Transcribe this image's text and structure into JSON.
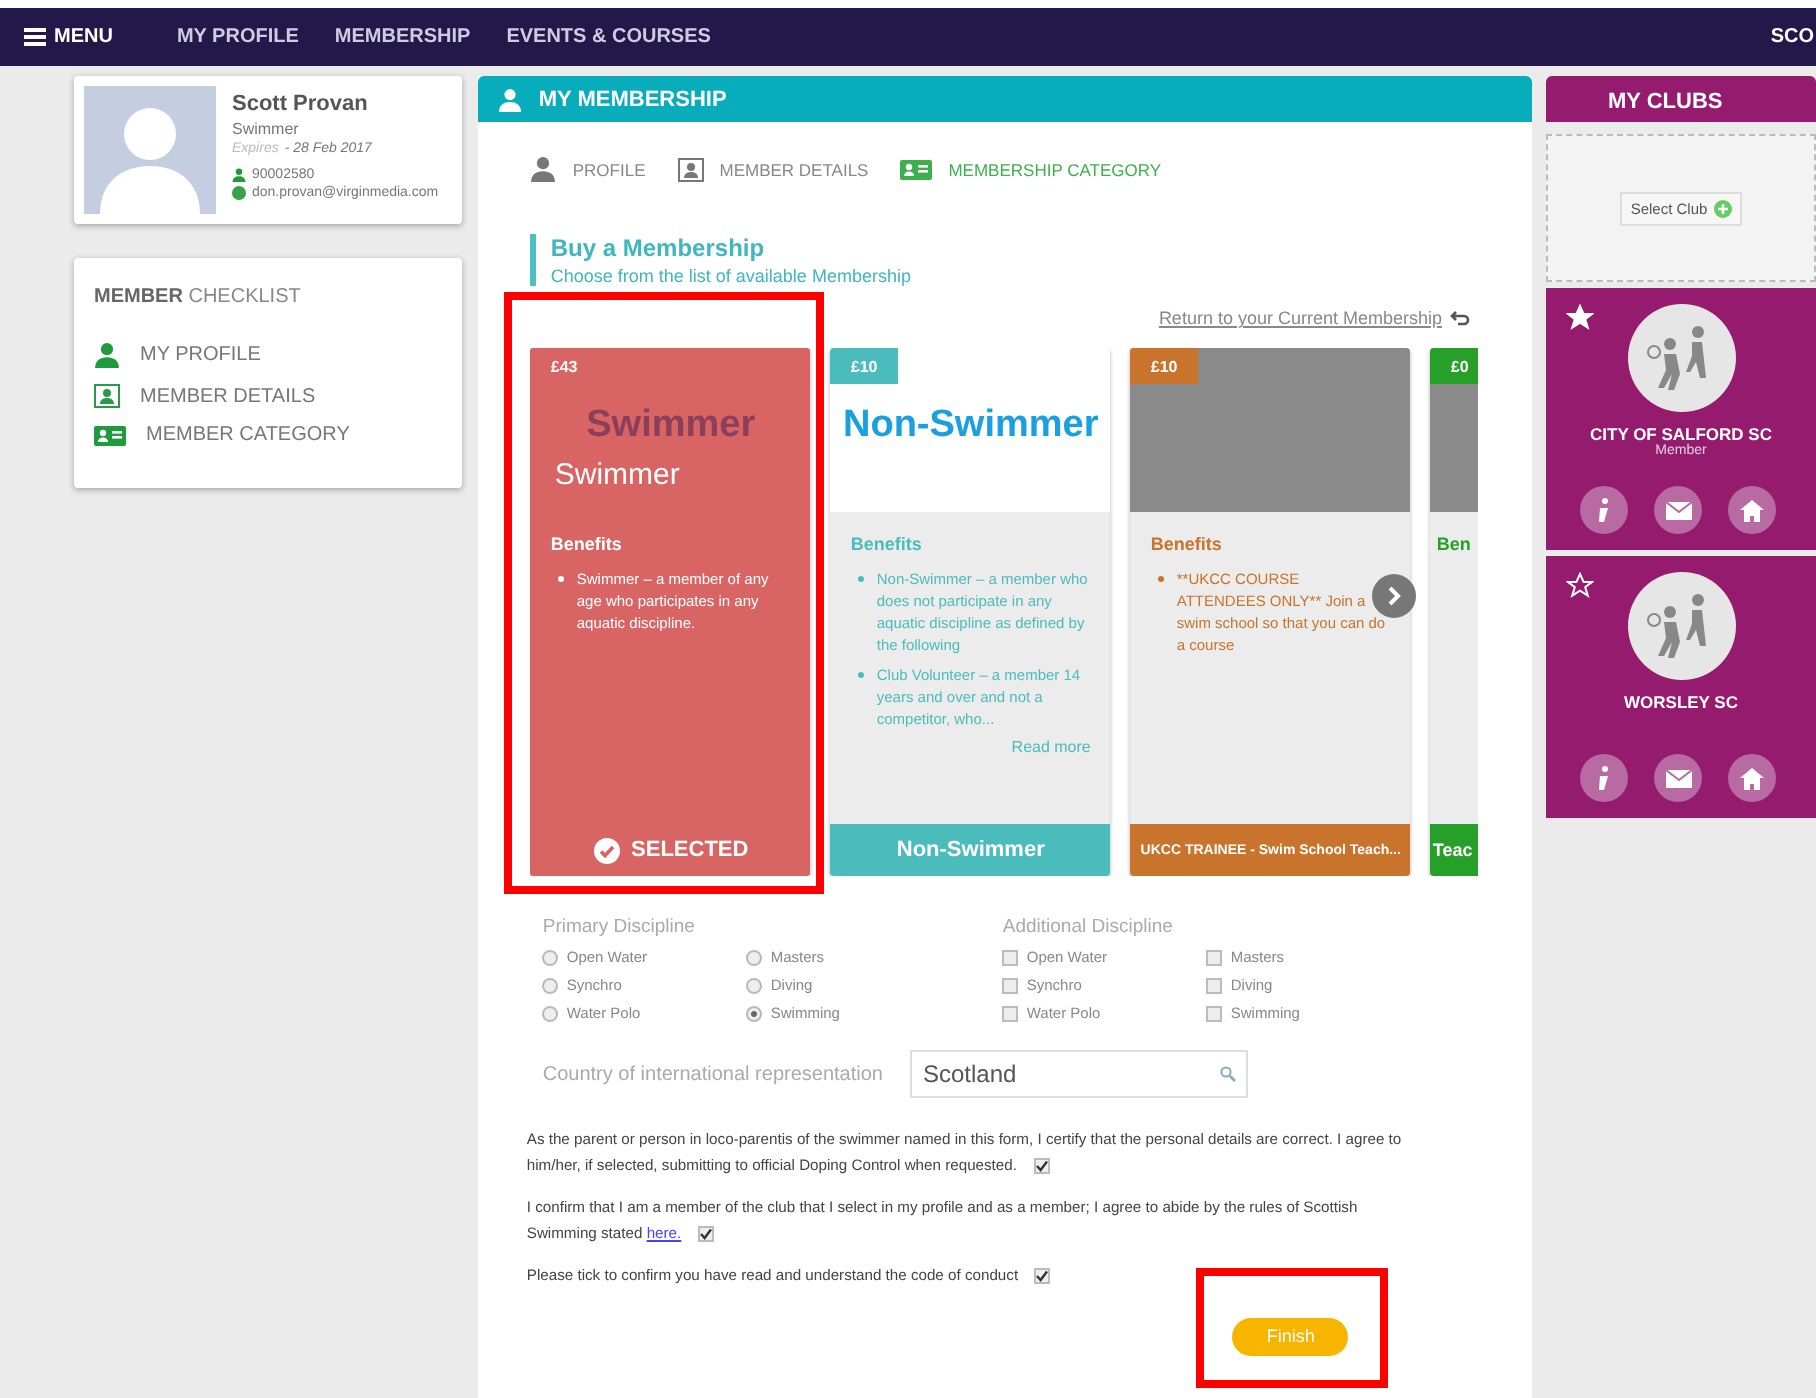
{
  "nav": {
    "menu": "MENU",
    "items": [
      {
        "label": "MY PROFILE"
      },
      {
        "label": "MEMBERSHIP"
      },
      {
        "label": "EVENTS & COURSES"
      }
    ],
    "user": "SCO"
  },
  "profile": {
    "name": "Scott Provan",
    "role": "Swimmer",
    "expires_label": "Expires",
    "expires_date": "- 28 Feb 2017",
    "member_id": "90002580",
    "email": "don.provan@virginmedia.com"
  },
  "checklist": {
    "title_bold": "MEMBER",
    "title_rest": "CHECKLIST",
    "items": [
      {
        "label": "MY PROFILE",
        "kind": "profile"
      },
      {
        "label": "MEMBER DETAILS",
        "kind": "details"
      },
      {
        "label": "MEMBER CATEGORY",
        "kind": "category"
      }
    ]
  },
  "membership": {
    "title": "MY MEMBERSHIP",
    "steps": [
      {
        "label": "PROFILE",
        "kind": "profile",
        "selected": false
      },
      {
        "label": "MEMBER DETAILS",
        "kind": "details",
        "selected": false
      },
      {
        "label": "MEMBERSHIP CATEGORY",
        "kind": "category",
        "selected": true
      }
    ],
    "buy_title": "Buy a Membership",
    "buy_subtitle": "Choose from the list of available Membership",
    "return_link": "Return to your Current Membership",
    "cards": [
      {
        "price": "£43",
        "title": "Swimmer",
        "subtitle": "Swimmer",
        "benefits_title": "Benefits",
        "benefits": [
          "Swimmer – a member of any age who participates in any aquatic discipline."
        ],
        "footer": "SELECTED",
        "selected": true,
        "color": "#d96464"
      },
      {
        "price": "£10",
        "title": "Non-Swimmer",
        "benefits_title": "Benefits",
        "benefits": [
          "Non-Swimmer – a member who does not participate in any aquatic discipline as defined by the following",
          "Club Volunteer – a member 14 years and over and not a competitor, who..."
        ],
        "read_more": "Read more",
        "footer": "Non-Swimmer",
        "selected": false,
        "color": "#4bbcbc"
      },
      {
        "price": "£10",
        "benefits_title": "Benefits",
        "benefits": [
          "**UKCC COURSE ATTENDEES ONLY** Join a swim school so that you can do a course"
        ],
        "footer": "UKCC TRAINEE - Swim School Teach...",
        "selected": false,
        "color": "#c8742c"
      },
      {
        "price": "£0",
        "benefits_title": "Ben",
        "footer": "Teac",
        "selected": false,
        "color": "#27a02a"
      }
    ],
    "primary_discipline": {
      "label": "Primary Discipline",
      "options": [
        {
          "label": "Open Water",
          "selected": false
        },
        {
          "label": "Masters",
          "selected": false
        },
        {
          "label": "Synchro",
          "selected": false
        },
        {
          "label": "Diving",
          "selected": false
        },
        {
          "label": "Water Polo",
          "selected": false
        },
        {
          "label": "Swimming",
          "selected": true
        }
      ]
    },
    "additional_discipline": {
      "label": "Additional Discipline",
      "options": [
        {
          "label": "Open Water",
          "checked": false
        },
        {
          "label": "Masters",
          "checked": false
        },
        {
          "label": "Synchro",
          "checked": false
        },
        {
          "label": "Diving",
          "checked": false
        },
        {
          "label": "Water Polo",
          "checked": false
        },
        {
          "label": "Swimming",
          "checked": false
        }
      ]
    },
    "country": {
      "label": "Country of international representation",
      "value": "Scotland"
    },
    "declarations": [
      {
        "text": "As the parent or person in loco-parentis of the swimmer named in this form, I certify that the personal details are correct. I agree to him/her, if selected, submitting to official Doping Control when requested.",
        "checked": true
      },
      {
        "text": "I confirm that I am a member of the club that I select in my profile and as a member; I agree to abide by the rules of Scottish Swimming stated",
        "link": "here.",
        "checked": true
      },
      {
        "text": "Please tick to confirm you have read and understand the code of conduct",
        "checked": true
      }
    ],
    "finish": "Finish"
  },
  "clubs": {
    "title": "MY CLUBS",
    "select_club": "Select Club",
    "items": [
      {
        "name": "CITY OF SALFORD SC",
        "role": "Member",
        "favourite": true
      },
      {
        "name": "WORSLEY SC",
        "favourite": false
      }
    ]
  }
}
